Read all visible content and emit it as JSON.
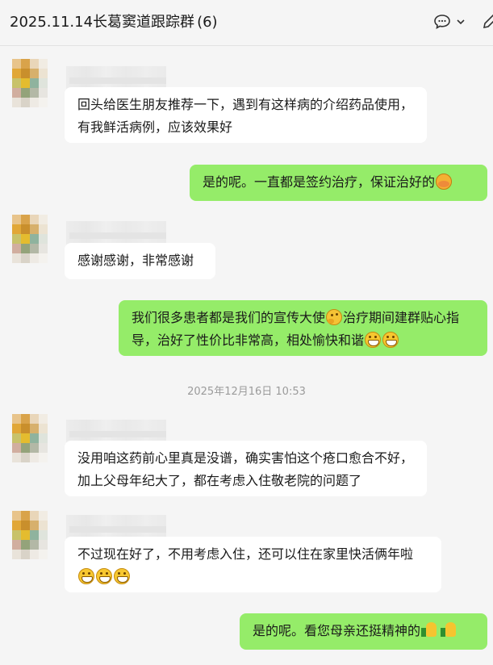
{
  "header": {
    "title": "2025.11.14长葛窦道跟踪群",
    "member_count": "(6)",
    "icons": [
      "chat-bubble-icon",
      "chevron-down-icon",
      "edit-icon"
    ]
  },
  "messages": [
    {
      "side": "in",
      "text": "回头给医生朋友推荐一下，遇到有这样病的介绍药品使用，有我鲜活病例，应该效果好"
    },
    {
      "side": "out",
      "text": "是的呢。一直都是签约治疗，保证治好的",
      "emoji": [
        "shy-face-emoji"
      ]
    },
    {
      "side": "in",
      "text": "感谢感谢，非常感谢"
    },
    {
      "side": "out",
      "text_a": "我们很多患者都是我们的宣传大使",
      "text_b": "治疗期间建群贴心指导，治好了性价比非常高，相处愉快和谐",
      "emoji": [
        "thinking-face-emoji",
        "grin-emoji",
        "grin-emoji"
      ]
    },
    {
      "side": "in",
      "text": "没用咱这药前心里真是没谱，确实害怕这个疮口愈合不好，加上父母年纪大了，都在考虑入住敬老院的问题了"
    },
    {
      "side": "in",
      "text": "不过现在好了，不用考虑入住，还可以住在家里快活俩年啦",
      "emoji": [
        "grin-emoji",
        "grin-emoji",
        "grin-emoji"
      ]
    },
    {
      "side": "out",
      "text": "是的呢。看您母亲还挺精神的",
      "emoji": [
        "thumbs-up-emoji",
        "thumbs-up-emoji"
      ]
    }
  ],
  "timestamp": "2025年12月16日 10:53",
  "colors": {
    "background": "#f5f5f5",
    "incoming_bubble": "#ffffff",
    "outgoing_bubble": "#95ec69",
    "timestamp_text": "#9b9b9b"
  }
}
